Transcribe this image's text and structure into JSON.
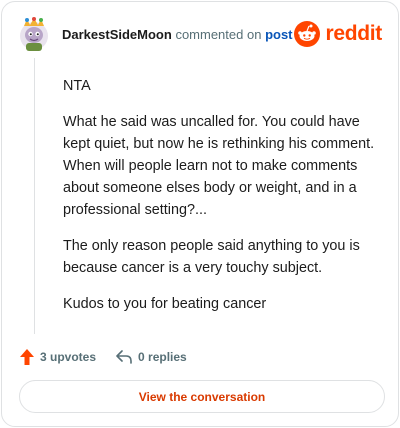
{
  "header": {
    "username": "DarkestSideMoon",
    "action_text": "commented on",
    "post_link": "post"
  },
  "brand": {
    "wordmark": "reddit",
    "color": "#ff4500"
  },
  "comment": {
    "paragraphs": [
      "NTA",
      "What he said was uncalled for. You could have kept quiet, but now he is rethinking his comment. When will people learn not to make comments about someone elses body or weight, and in a professional setting?...",
      "The only reason people said anything to you is because cancer is a very touchy subject.",
      "Kudos to you for beating cancer"
    ]
  },
  "actions": {
    "upvotes_label": "3 upvotes",
    "replies_label": "0 replies"
  },
  "cta": {
    "label": "View the conversation"
  },
  "colors": {
    "accent": "#d93a00",
    "upvote": "#ff4500",
    "link": "#0a56b8",
    "muted": "#576f76"
  }
}
